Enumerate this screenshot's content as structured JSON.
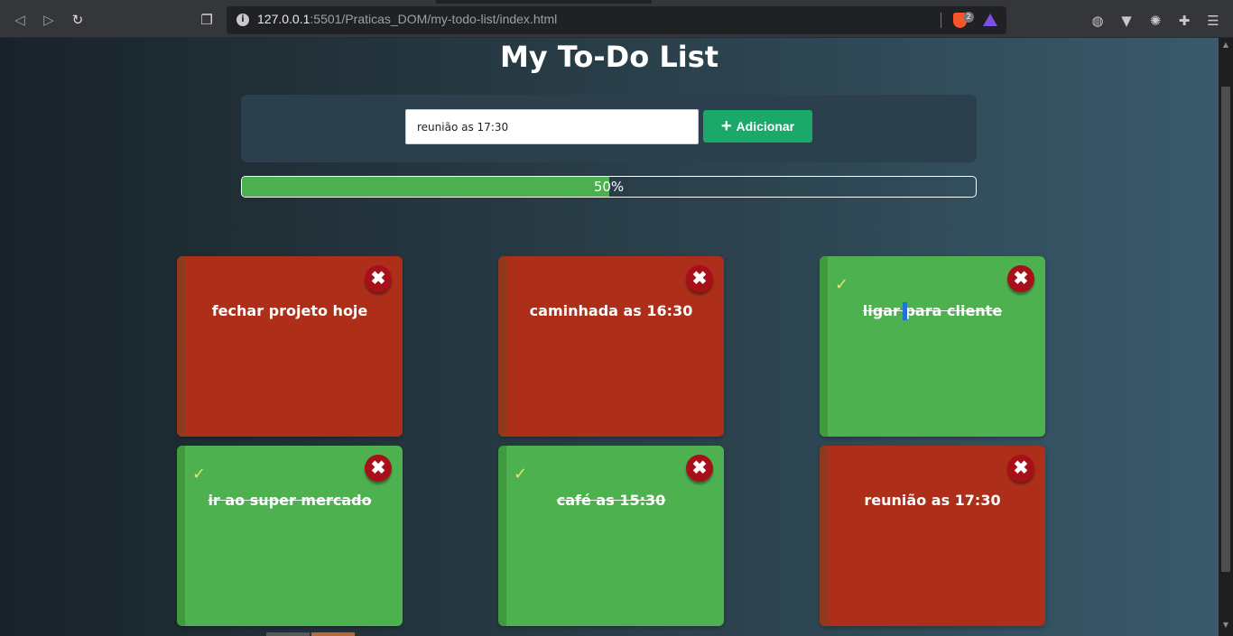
{
  "browser": {
    "url_host": "127.0.0.1",
    "url_path": ":5501/Praticas_DOM/my-todo-list/index.html",
    "shield_count": "2"
  },
  "app": {
    "title": "My To-Do List",
    "input": {
      "value": "reunião as 17:30",
      "placeholder": ""
    },
    "add_button_label": "Adicionar",
    "progress": {
      "percent": 50,
      "label": "50%"
    }
  },
  "tasks": [
    {
      "text": "fechar projeto hoje",
      "done": false,
      "remove_icon": "close-icon"
    },
    {
      "text": "caminhada as 16:30",
      "done": false,
      "remove_icon": "close-icon"
    },
    {
      "text": "ligar para cliente",
      "done": true,
      "remove_icon": "close-icon"
    },
    {
      "text": "ir ao super mercado",
      "done": true,
      "remove_icon": "close-icon"
    },
    {
      "text": "café as 15:30",
      "done": true,
      "remove_icon": "close-icon"
    },
    {
      "text": "reunião as 17:30",
      "done": false,
      "remove_icon": "close-icon"
    }
  ],
  "colors": {
    "pending": "#ad2e19",
    "done": "#4db150",
    "accent": "#1aa968"
  }
}
